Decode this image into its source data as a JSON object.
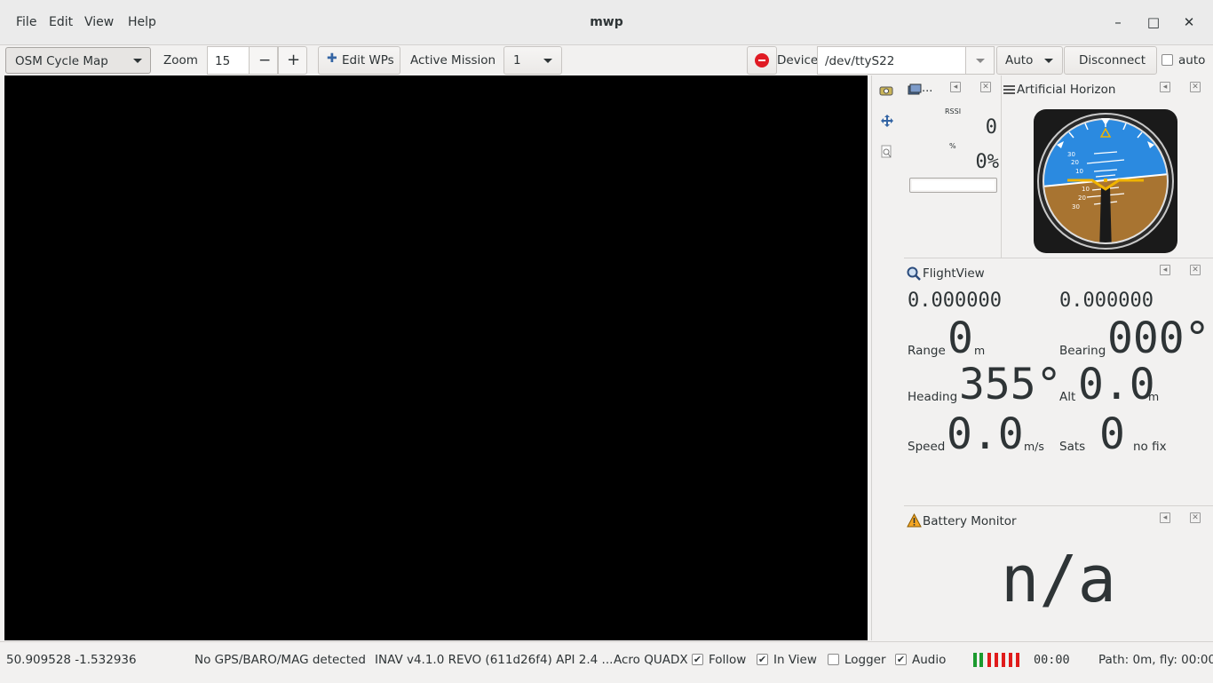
{
  "window": {
    "title": "mwp",
    "menu": [
      "File",
      "Edit",
      "View",
      "Help"
    ],
    "minimize_glyph": "–",
    "maximize_glyph": "□",
    "close_glyph": "✕"
  },
  "toolbar": {
    "map_source": "OSM Cycle Map",
    "zoom_label": "Zoom",
    "zoom_value": "15",
    "zoom_minus": "−",
    "zoom_plus": "+",
    "edit_wps_icon": "✚",
    "edit_wps_label": "Edit WPs",
    "active_mission_label": "Active Mission",
    "active_mission_value": "1",
    "device_label": "Device",
    "device_value": "/dev/ttyS22",
    "speed_value": "Auto",
    "disconnect_label": "Disconnect",
    "auto_label": "auto"
  },
  "radio_panel": {
    "title": "...",
    "rssi_label": "RSSI",
    "rssi_value": "0",
    "percent_label": "%",
    "percent_value": "0%",
    "level_fraction": 0
  },
  "horizon_panel": {
    "title": "Artificial Horizon",
    "pitch_marks": [
      "30",
      "20",
      "10",
      "10",
      "20",
      "30"
    ]
  },
  "flightview": {
    "title": "FlightView",
    "lat": "0.000000",
    "lon": "0.000000",
    "range_label": "Range",
    "range_value": "0",
    "range_unit": "m",
    "bearing_label": "Bearing",
    "bearing_value": "000°",
    "heading_label": "Heading",
    "heading_value": "355°",
    "alt_label": "Alt",
    "alt_value": "0.0",
    "alt_unit": "m",
    "speed_label": "Speed",
    "speed_value": "0.0",
    "speed_unit": "m/s",
    "sats_label": "Sats",
    "sats_value": "0",
    "sats_fix": "no fix"
  },
  "battery": {
    "title": "Battery Monitor",
    "value": "n/a"
  },
  "status": {
    "coords": "50.909528  -1.532936",
    "sensors": "No GPS/BARO/MAG detected",
    "fc_info": "INAV v4.1.0  REVO (611d26f4) API 2.4 ...",
    "model": "Acro QUADX",
    "follow_label": "Follow",
    "in_view_label": "In View",
    "logger_label": "Logger",
    "audio_label": "Audio",
    "check_glyph": "✔",
    "time": "00:00",
    "path": "Path: 0m, fly: 00:00",
    "colors": {
      "ok": "#1c9a2e",
      "bad": "#e01b1b"
    }
  }
}
